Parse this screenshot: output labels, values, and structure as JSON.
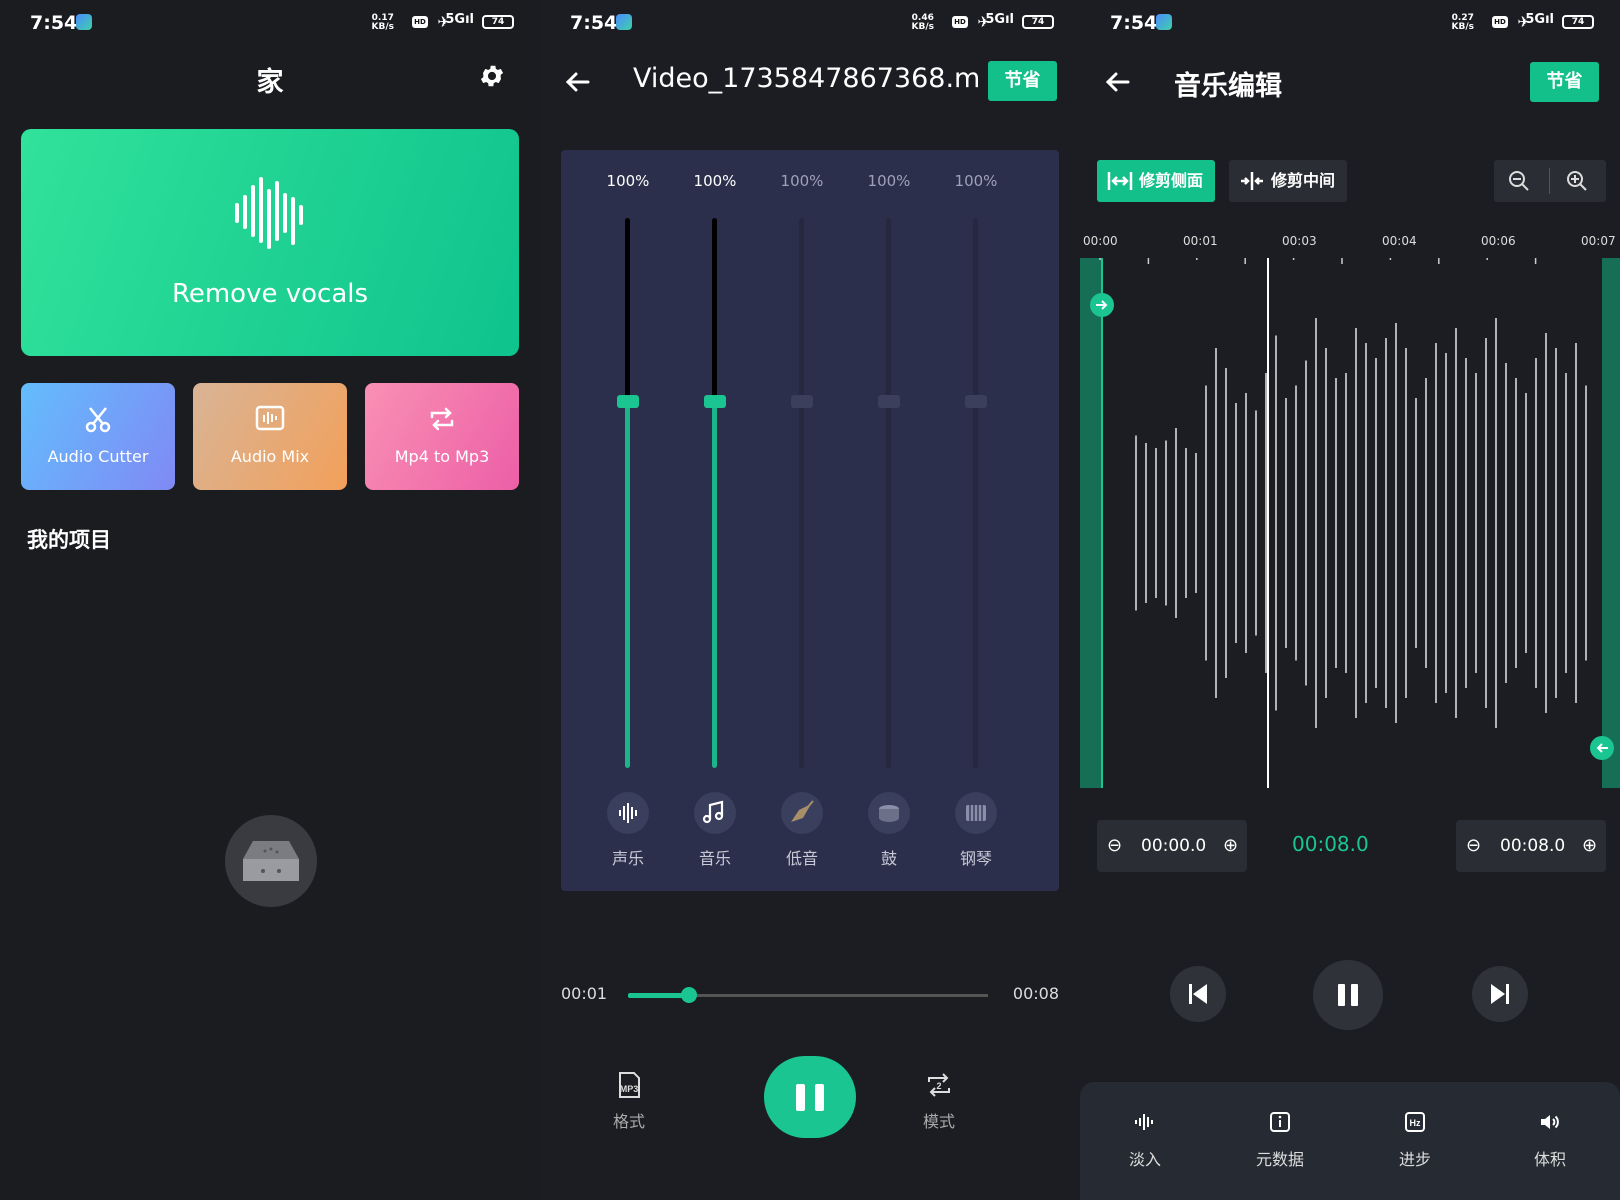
{
  "status": {
    "s1": {
      "time": "7:54",
      "speed": "0.17",
      "unit": "KB/s",
      "net": "5G",
      "battery": "74"
    },
    "s2": {
      "time": "7:54",
      "speed": "0.46",
      "unit": "KB/s",
      "net": "5G",
      "battery": "74"
    },
    "s3": {
      "time": "7:54",
      "speed": "0.27",
      "unit": "KB/s",
      "net": "5G",
      "battery": "74"
    }
  },
  "home": {
    "title": "家",
    "hero_label": "Remove vocals",
    "tools": [
      {
        "label": "Audio Cutter",
        "icon": "scissors-icon"
      },
      {
        "label": "Audio Mix",
        "icon": "waveform-box-icon"
      },
      {
        "label": "Mp4 to Mp3",
        "icon": "convert-arrows-icon"
      }
    ],
    "projects_heading": "我的项目"
  },
  "splitter": {
    "title": "Video_1735847867368.m...",
    "save_label": "节省",
    "channels": [
      {
        "name": "声乐",
        "percent": "100%",
        "level": 0.67,
        "active": true,
        "icon": "vocal-wave-icon"
      },
      {
        "name": "音乐",
        "percent": "100%",
        "level": 0.67,
        "active": true,
        "icon": "music-note-icon"
      },
      {
        "name": "低音",
        "percent": "100%",
        "level": 0.67,
        "active": false,
        "icon": "bass-guitar-icon"
      },
      {
        "name": "鼓",
        "percent": "100%",
        "level": 0.67,
        "active": false,
        "icon": "drum-icon"
      },
      {
        "name": "钢琴",
        "percent": "100%",
        "level": 0.67,
        "active": false,
        "icon": "piano-icon"
      }
    ],
    "position": "00:01",
    "duration": "00:08",
    "progress": 0.17,
    "format_label": "格式",
    "format_value": "MP3",
    "mode_label": "模式",
    "mode_value": "2"
  },
  "editor": {
    "title": "音乐编辑",
    "save_label": "节省",
    "trim_side": "修剪侧面",
    "trim_middle": "修剪中间",
    "ticks": [
      "00:00",
      "00:01",
      "00:03",
      "00:04",
      "00:06",
      "00:07"
    ],
    "start_time": "00:00.0",
    "end_time": "00:08.0",
    "duration": "00:08.0",
    "tools": [
      {
        "label": "淡入",
        "icon": "fade-wave-icon"
      },
      {
        "label": "元数据",
        "icon": "info-icon"
      },
      {
        "label": "进步",
        "icon": "hz-icon"
      },
      {
        "label": "体积",
        "icon": "volume-icon"
      }
    ]
  },
  "colors": {
    "accent": "#1bc592",
    "panel": "#2b2f4b"
  }
}
